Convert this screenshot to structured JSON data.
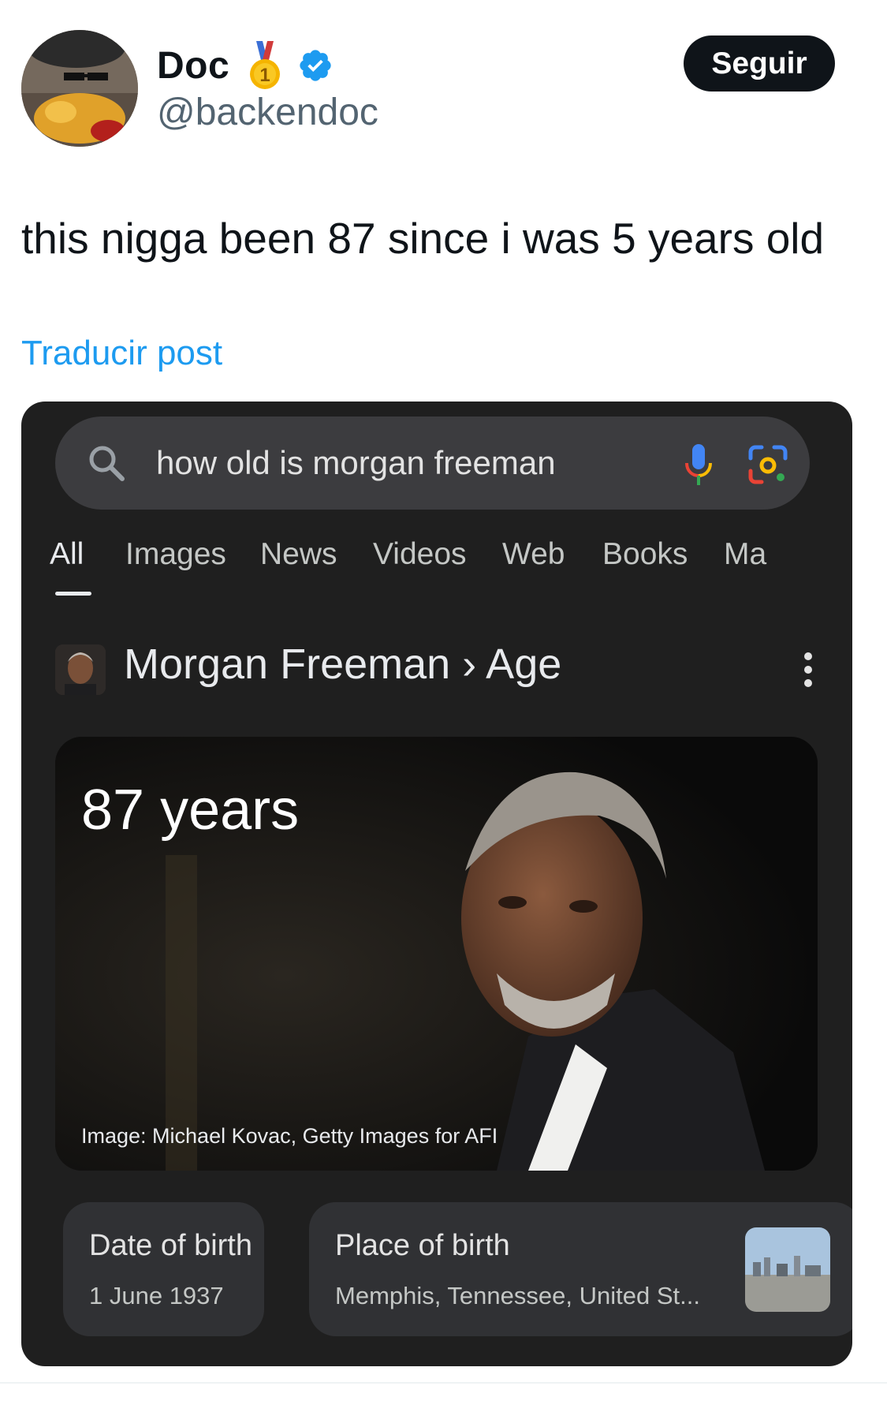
{
  "tweet": {
    "display_name": "Doc",
    "handle": "@backendoc",
    "follow_label": "Seguir",
    "text": "this nigga been 87 since i was 5 years old",
    "translate_label": "Traducir post",
    "medal_number": "1"
  },
  "embedded": {
    "search": {
      "query": "how old is morgan freeman"
    },
    "tabs": [
      "All",
      "Images",
      "News",
      "Videos",
      "Web",
      "Books",
      "Ma"
    ],
    "entity": {
      "title": "Morgan Freeman › Age"
    },
    "answer": {
      "value": "87 years",
      "image_credit": "Image: Michael Kovac, Getty Images for AFI"
    },
    "facts": [
      {
        "label": "Date of birth",
        "value": "1 June 1937"
      },
      {
        "label": "Place of birth",
        "value": "Memphis, Tennessee, United St..."
      }
    ]
  },
  "colors": {
    "link_blue": "#1d9bf0",
    "verified_blue": "#1d9bf0",
    "follow_bg": "#0f1419",
    "dark_bg": "#1f1f1f",
    "card_bg": "#303134"
  },
  "icons": [
    "medal-icon",
    "verified-badge-icon",
    "search-icon",
    "mic-icon",
    "lens-icon",
    "more-vert-icon"
  ]
}
